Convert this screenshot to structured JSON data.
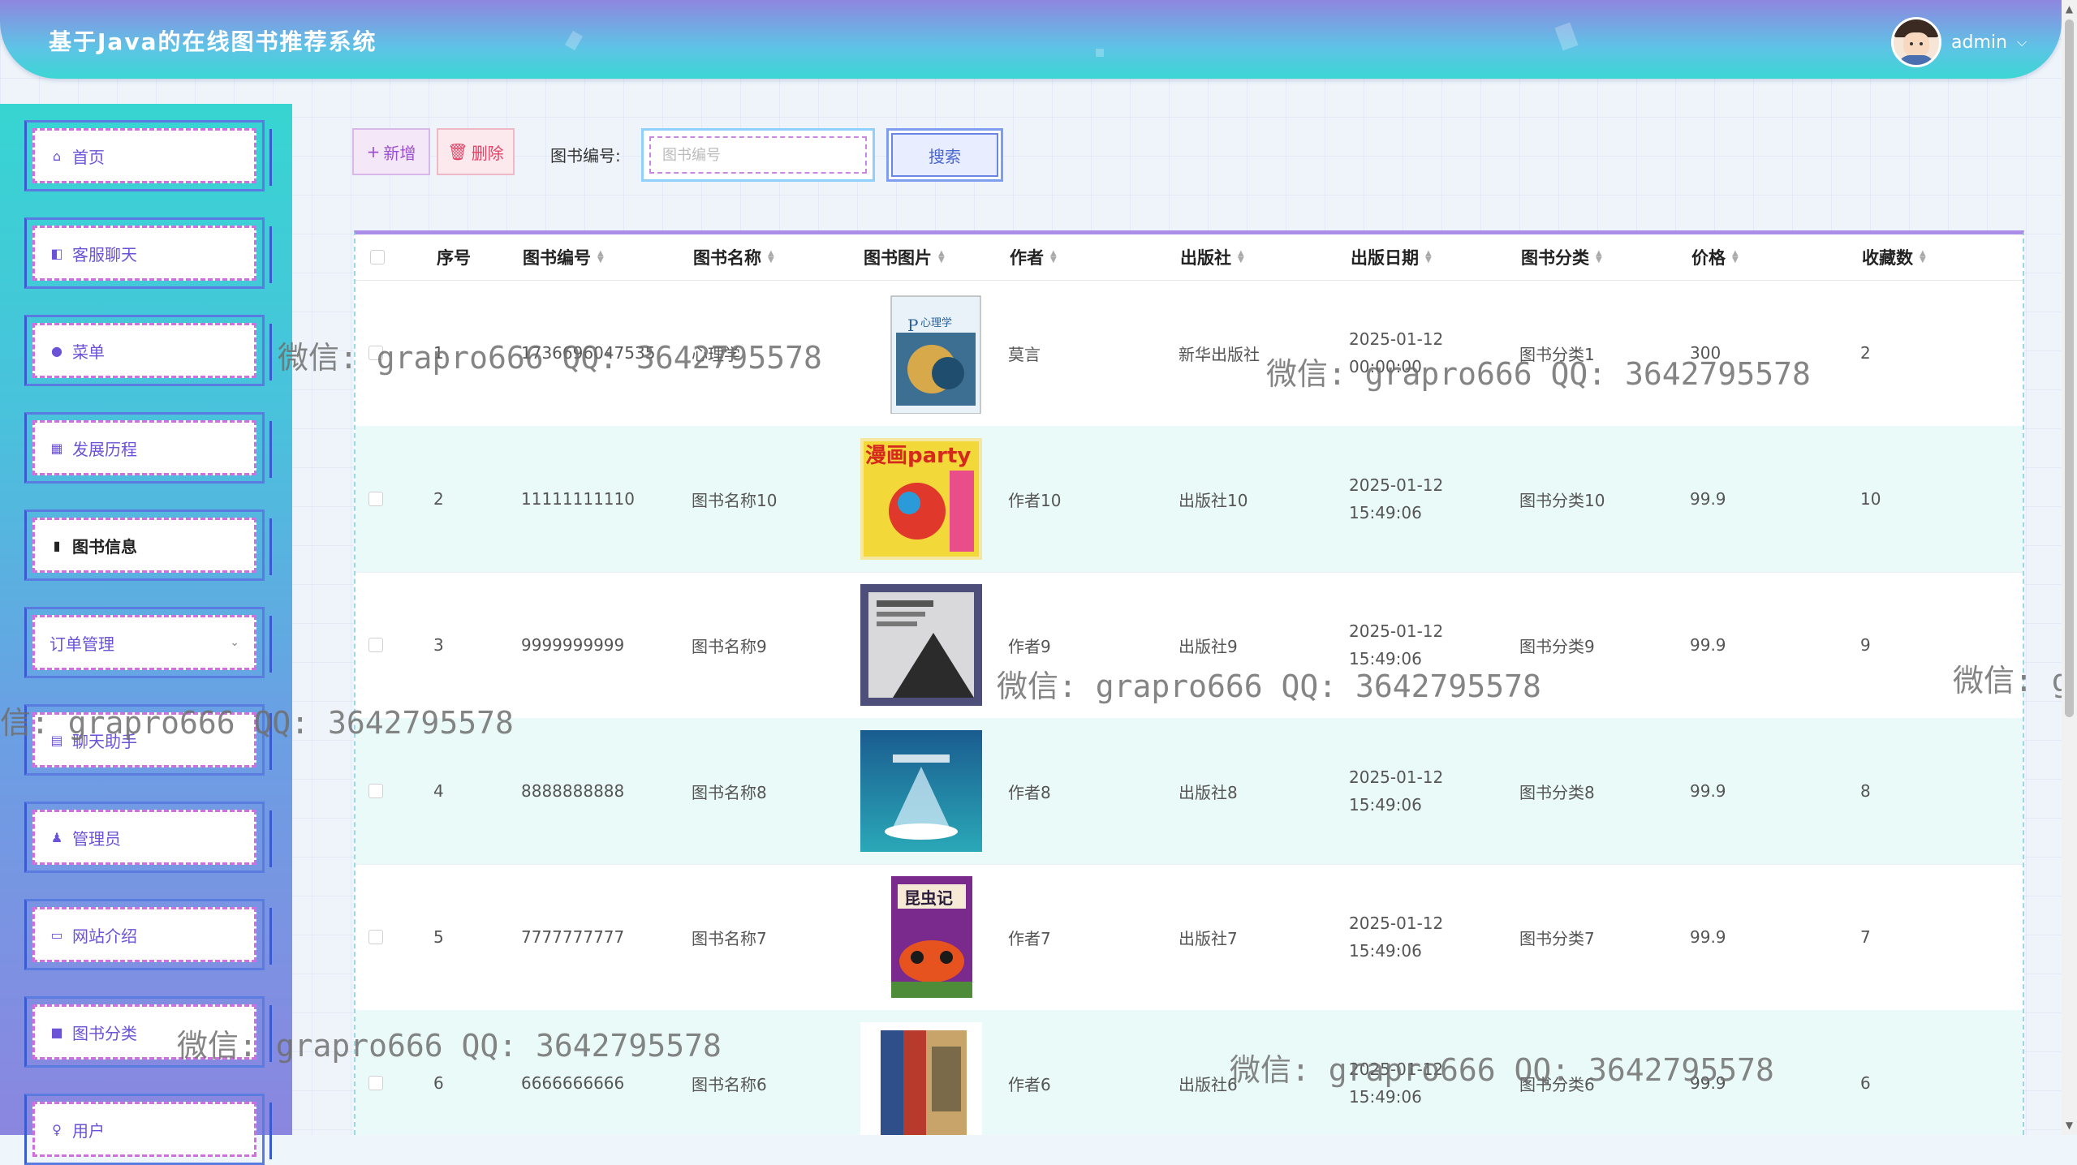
{
  "header": {
    "title": "基于Java的在线图书推荐系统",
    "user_name": "admin"
  },
  "sidebar": {
    "items": [
      {
        "label": "首页",
        "icon": "home-icon"
      },
      {
        "label": "客服聊天",
        "icon": "chat-window-icon"
      },
      {
        "label": "菜单",
        "icon": "menu-circle-icon"
      },
      {
        "label": "发展历程",
        "icon": "gift-icon"
      },
      {
        "label": "图书信息",
        "icon": "book-icon",
        "active": true
      },
      {
        "label": "订单管理",
        "icon": "",
        "has_children": true
      },
      {
        "label": "聊天助手",
        "icon": "calendar-icon"
      },
      {
        "label": "管理员",
        "icon": "user-icon"
      },
      {
        "label": "网站介绍",
        "icon": "folder-icon"
      },
      {
        "label": "图书分类",
        "icon": "square-icon"
      },
      {
        "label": "用户",
        "icon": "person-icon"
      }
    ]
  },
  "toolbar": {
    "add_label": "新增",
    "delete_label": "删除",
    "search_label": "图书编号:",
    "search_placeholder": "图书编号",
    "search_button": "搜索"
  },
  "table": {
    "columns": [
      "序号",
      "图书编号",
      "图书名称",
      "图书图片",
      "作者",
      "出版社",
      "出版日期",
      "图书分类",
      "价格",
      "收藏数"
    ],
    "rows": [
      {
        "index": "1",
        "code": "1736696047535",
        "name": "心理学",
        "author": "莫言",
        "publisher": "新华出版社",
        "date": "2025-01-12 00:00:00",
        "category": "图书分类1",
        "price": "300",
        "favorites": "2"
      },
      {
        "index": "2",
        "code": "11111111110",
        "name": "图书名称10",
        "author": "作者10",
        "publisher": "出版社10",
        "date": "2025-01-12 15:49:06",
        "category": "图书分类10",
        "price": "99.9",
        "favorites": "10"
      },
      {
        "index": "3",
        "code": "9999999999",
        "name": "图书名称9",
        "author": "作者9",
        "publisher": "出版社9",
        "date": "2025-01-12 15:49:06",
        "category": "图书分类9",
        "price": "99.9",
        "favorites": "9"
      },
      {
        "index": "4",
        "code": "8888888888",
        "name": "图书名称8",
        "author": "作者8",
        "publisher": "出版社8",
        "date": "2025-01-12 15:49:06",
        "category": "图书分类8",
        "price": "99.9",
        "favorites": "8"
      },
      {
        "index": "5",
        "code": "7777777777",
        "name": "图书名称7",
        "author": "作者7",
        "publisher": "出版社7",
        "date": "2025-01-12 15:49:06",
        "category": "图书分类7",
        "price": "99.9",
        "favorites": "7"
      },
      {
        "index": "6",
        "code": "6666666666",
        "name": "图书名称6",
        "author": "作者6",
        "publisher": "出版社6",
        "date": "2025-01-12 15:49:06",
        "category": "图书分类6",
        "price": "99.9",
        "favorites": "6"
      }
    ]
  },
  "cover_text": {
    "r1": "心理学",
    "r2": "漫画party",
    "r5": "昆虫记"
  },
  "watermark": "微信: grapro666 QQ: 3642795578",
  "watermark_partial_left": "信: grapro666 QQ: 3642795578",
  "watermark_partial_right": "微信: g"
}
